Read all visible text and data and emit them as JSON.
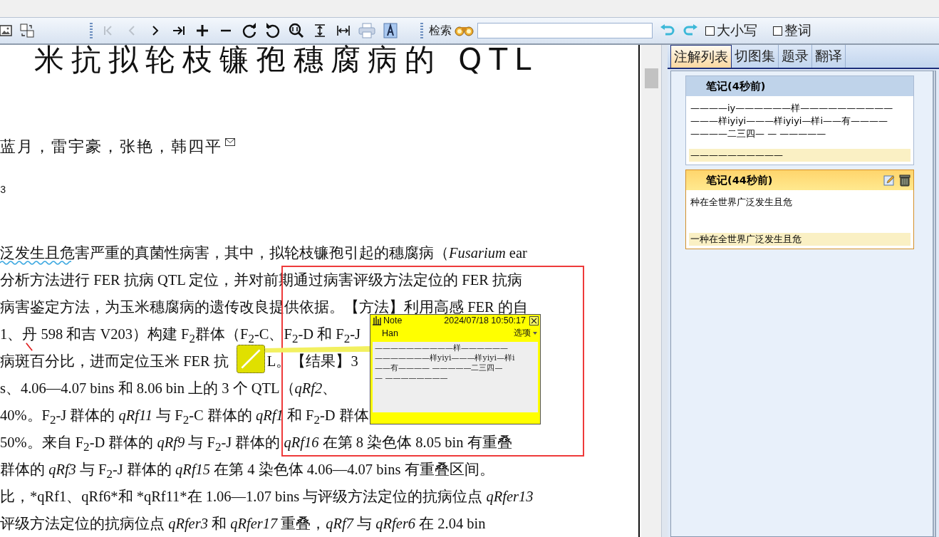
{
  "toolbar": {
    "file_tools": [
      {
        "kind": "image",
        "disabled": false
      },
      {
        "kind": "translate",
        "disabled": false
      }
    ],
    "view_tools": [
      {
        "kind": "first",
        "disabled": true
      },
      {
        "kind": "prev",
        "disabled": true
      },
      {
        "kind": "next",
        "disabled": false
      },
      {
        "kind": "last",
        "disabled": false
      },
      {
        "kind": "zoom-in",
        "disabled": false
      },
      {
        "kind": "zoom-out",
        "disabled": false
      },
      {
        "kind": "rotate-cw",
        "disabled": false
      },
      {
        "kind": "rotate-ccw",
        "disabled": false
      },
      {
        "kind": "zoom-fit",
        "disabled": false
      },
      {
        "kind": "fit-height",
        "disabled": false
      },
      {
        "kind": "fit-width",
        "disabled": false
      },
      {
        "kind": "print",
        "disabled": false
      },
      {
        "kind": "text-select",
        "disabled": false
      }
    ],
    "search": {
      "label": "检索"
    },
    "options": [
      {
        "label": "大小写",
        "checked": false
      },
      {
        "label": "整词",
        "checked": false
      }
    ]
  },
  "document": {
    "title": "米抗拟轮枝镰孢穗腐病的 QTL",
    "authors": "蓝月，雷宇豪，张艳，韩四平",
    "affiliation": "3",
    "lines": [
      {
        "parts": [
          "泛发生且危害严重的真菌性病害，其中，拟轮枝镰孢引起的穗腐病（*Fusarium* ear"
        ]
      },
      {
        "parts": [
          "分析方法进行 FER 抗病 QTL 定位，并对前期通过病害评级方法定位的 FER 抗病"
        ]
      },
      {
        "parts": [
          "病害鉴定方法，为玉米穗腐病的遗传改良提供依据。【方法】利用高感 FER 的自"
        ]
      },
      {
        "parts": [
          "1、丹 598 和吉 V203）构建 F$_{2}$群体（F$_{2}$-C、F$_{2}$-D 和 F$_{2}$-J"
        ]
      },
      {
        "parts": [
          "病斑百分比，进而定位玉米 FER 抗",
          "L。【结果】3"
        ]
      },
      {
        "parts": [
          "s、4.06—4.07 bins 和 8.06 bin 上的 3 个 QTL（*qRf2*、"
        ]
      },
      {
        "parts": [
          "40%。F$_{2}$-J 群体的 *qRf11* 与 F$_{2}$-C 群体的 *qRf1* 和 F$_{2}$-D 群体"
        ]
      },
      {
        "parts": [
          "50%。来自 F$_{2}$-D 群体的 *qRf9* 与 F$_{2}$-J 群体的 *qRf16* 在第 8 染色体 8.05 bin 有重叠"
        ]
      },
      {
        "parts": [
          "群体的 *qRf3* 与 F$_{2}$-J 群体的 *qRf15* 在第 4 染色体 4.06—4.07 bins 有重叠区间。"
        ]
      },
      {
        "parts": [
          "比，*qRf1、qRf6*和 *qRf11*在 1.06—1.07 bins 与评级方法定位的抗病位点 *qRfer13*"
        ]
      },
      {
        "parts": [
          "评级方法定位的抗病位点 *qRfer3* 和 *qRfer17* 重叠，*qRf7* 与 *qRfer6* 在 2.04 bin"
        ]
      }
    ]
  },
  "note_popup": {
    "title": "Note",
    "timestamp": "2024/07/18 10:50:17",
    "author": "Han",
    "menu": "选项",
    "text": "——————————样——————\n———————样yiyi———样yiyi—样i\n——有———— —————二三四—\n— ————————"
  },
  "side_panel": {
    "tabs": [
      {
        "label": "注解列表",
        "selected": true
      },
      {
        "label": "切图集",
        "selected": false
      },
      {
        "label": "题录",
        "selected": false
      },
      {
        "label": "翻译",
        "selected": false
      }
    ],
    "notes": [
      {
        "title": "笔记(4秒前)",
        "body": "————iy——————样——————————\n———样iyiyi———样iyiyi—样i——有————\n————二三四— — —————",
        "quote": "——————————",
        "selected": false
      },
      {
        "title": "笔记(44秒前)",
        "body": "种在全世界广泛发生且危",
        "quote": "一种在全世界广泛发生且危",
        "selected": true
      }
    ]
  }
}
